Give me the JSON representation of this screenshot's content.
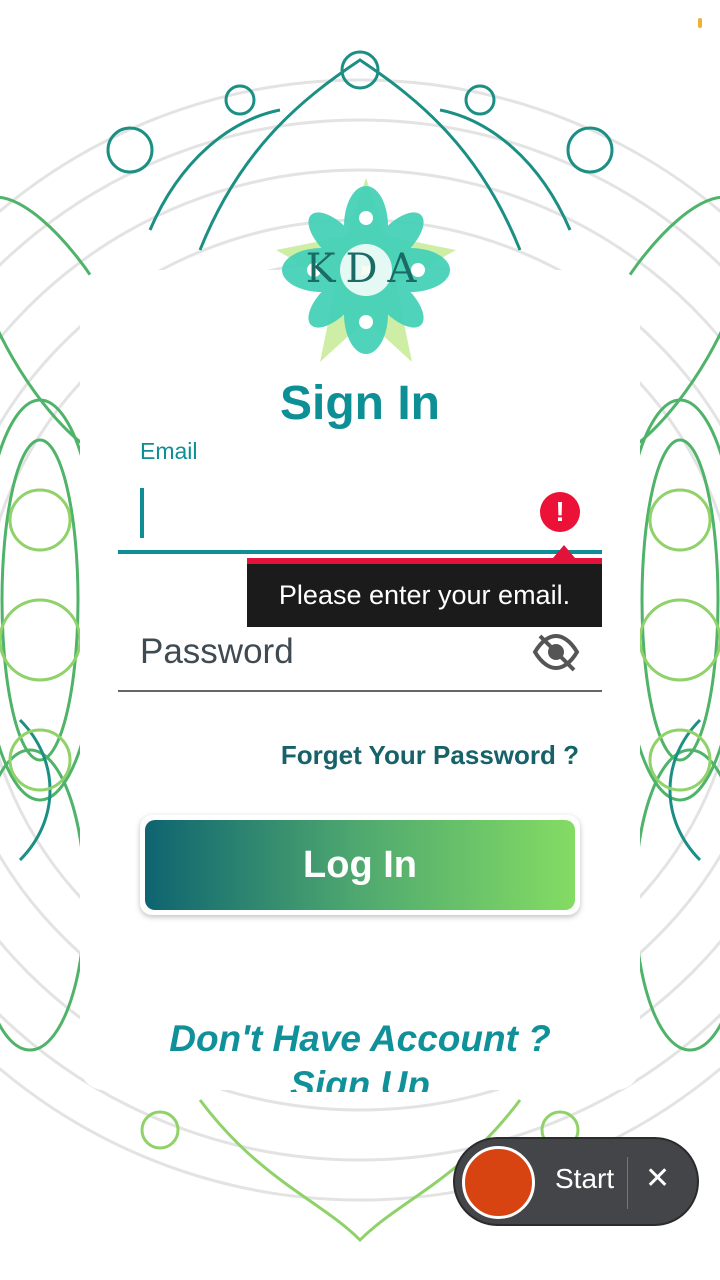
{
  "app": {
    "logo_text": "KDA",
    "title": "Sign In"
  },
  "form": {
    "email_label": "Email",
    "email_value": "",
    "email_error": "Please enter your email.",
    "password_placeholder": "Password",
    "forgot_password": "Forget Your Password ?",
    "login_button": "Log In",
    "signup_prompt": "Don't Have Account ?",
    "signup_link": "Sign Up"
  },
  "recorder": {
    "start_label": "Start",
    "close_label": "✕"
  },
  "colors": {
    "accent": "#0c8f95",
    "error": "#ec1237",
    "button_gradient_start": "#0e6470",
    "button_gradient_end": "#84dc63",
    "recorder_dot": "#d84312"
  }
}
